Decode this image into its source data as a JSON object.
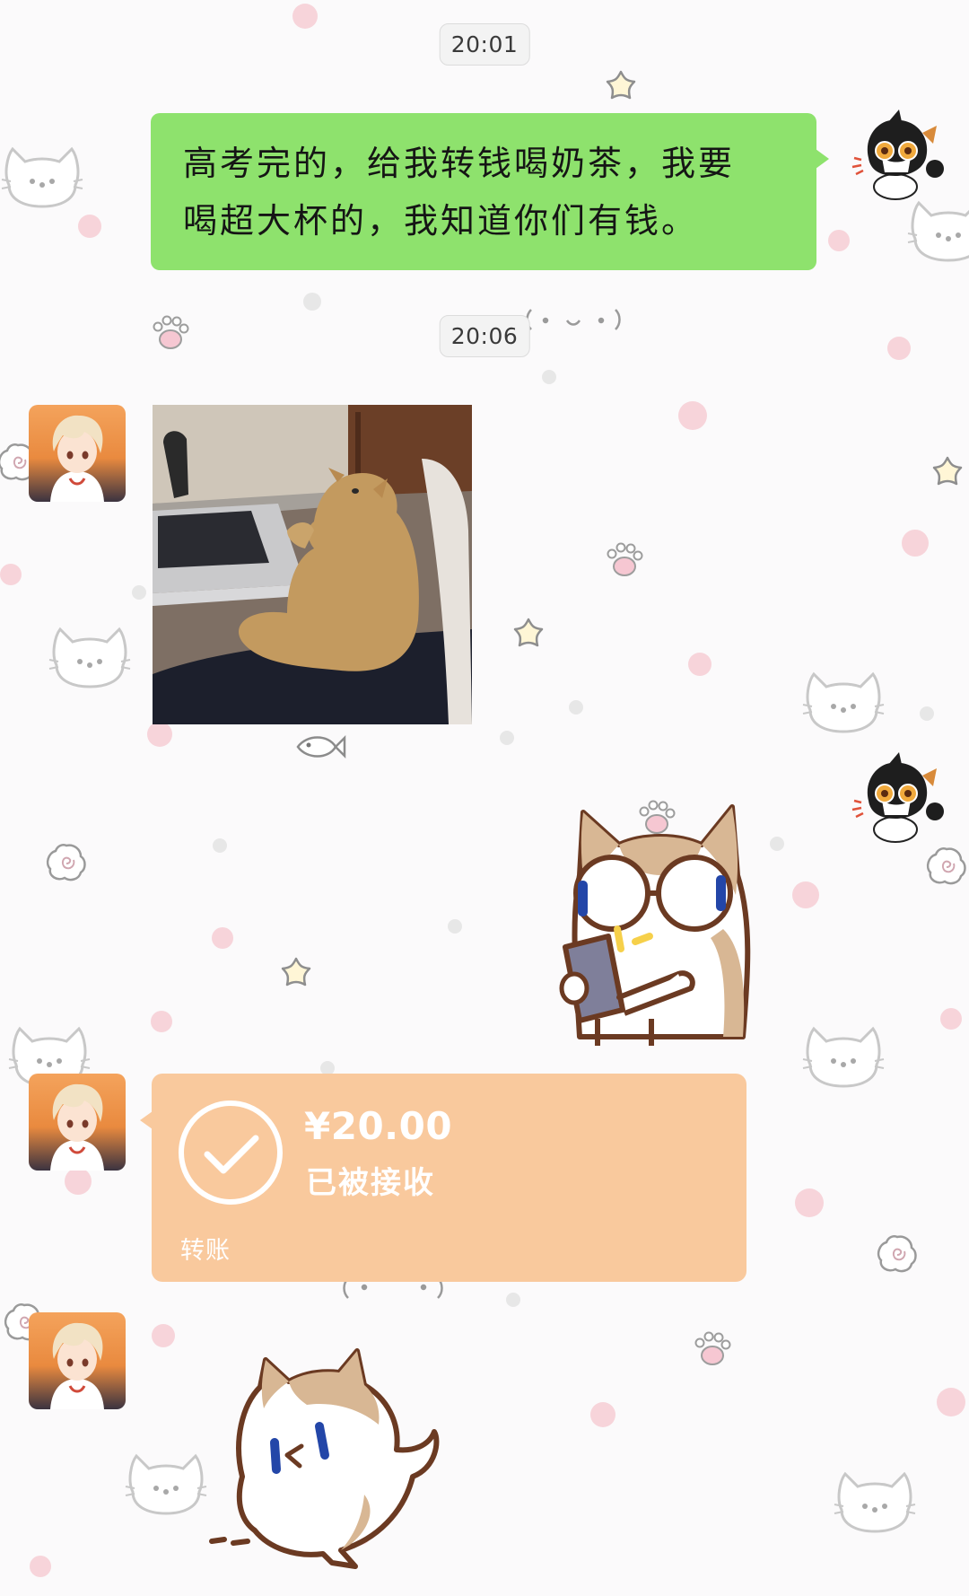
{
  "timestamps": [
    "20:01",
    "20:06"
  ],
  "messages": {
    "sent_text": "高考完的，给我转钱喝奶茶，我要喝超大杯的，我知道你们有钱。",
    "sent_text_line1": "高考完的，给我转钱喝奶茶，我要",
    "sent_text_line2": "喝超大杯的，我知道你们有钱。"
  },
  "transfer": {
    "amount": "¥20.00",
    "status": "已被接收",
    "label": "转账"
  },
  "icons": {
    "check": "check-circle-icon"
  },
  "colors": {
    "sent_bubble": "#8ee26d",
    "transfer_card": "#f9c99d",
    "background": "#fbfafb"
  }
}
